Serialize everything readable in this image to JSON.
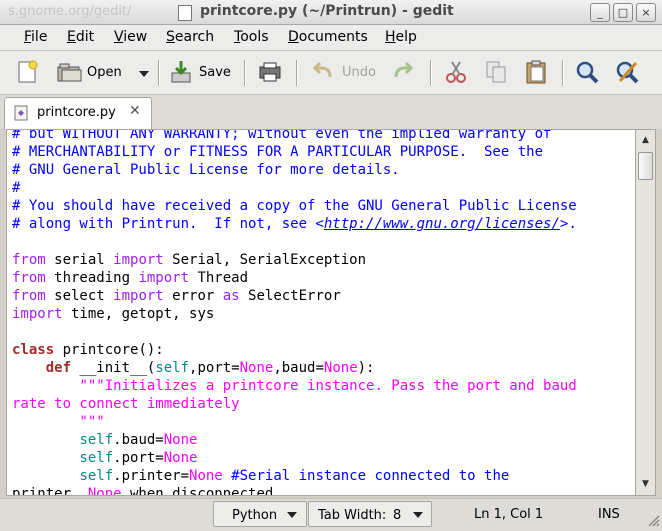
{
  "window": {
    "ghost_text": "s.gnome.org/gedit/",
    "title": "printcore.py (~/Printrun) - gedit",
    "controls": [
      "_",
      "□",
      "×"
    ]
  },
  "menu": [
    {
      "label": "File",
      "key": "F",
      "rest": "ile"
    },
    {
      "label": "Edit",
      "key": "E",
      "rest": "dit"
    },
    {
      "label": "View",
      "key": "V",
      "rest": "iew"
    },
    {
      "label": "Search",
      "key": "S",
      "rest": "earch"
    },
    {
      "label": "Tools",
      "key": "T",
      "rest": "ools"
    },
    {
      "label": "Documents",
      "key": "D",
      "rest": "ocuments"
    },
    {
      "label": "Help",
      "key": "H",
      "rest": "elp"
    }
  ],
  "toolbar": {
    "open_label": "Open",
    "save_label": "Save",
    "undo_label": "Undo"
  },
  "tab": {
    "filename": "printcore.py",
    "close": "✕"
  },
  "code_lines": [
    "# but WITHOUT ANY WARRANTY; without even the implied warranty of",
    "# MERCHANTABILITY or FITNESS FOR A PARTICULAR PURPOSE.  See the",
    "# GNU General Public License for more details.",
    "#",
    "# You should have received a copy of the GNU General Public License",
    "# along with Printrun.  If not, see <http://www.gnu.org/licenses/>.",
    "",
    "from serial import Serial, SerialException",
    "from threading import Thread",
    "from select import error as SelectError",
    "import time, getopt, sys",
    "",
    "class printcore():",
    "    def __init__(self,port=None,baud=None):",
    "        \"\"\"Initializes a printcore instance. Pass the port and baud",
    "rate to connect immediately",
    "        \"\"\"",
    "        self.baud=None",
    "        self.port=None",
    "        self.printer=None #Serial instance connected to the",
    "printer, None when disconnected"
  ],
  "statusbar": {
    "language": "Python",
    "tab_width_label": "Tab Width:",
    "tab_width_value": "8",
    "position": "Ln 1, Col 1",
    "mode": "INS"
  },
  "colors": {
    "comment": "#0000ff",
    "keyword": "#a52a2a",
    "string": "#ff00ff",
    "self": "#008a8c"
  }
}
